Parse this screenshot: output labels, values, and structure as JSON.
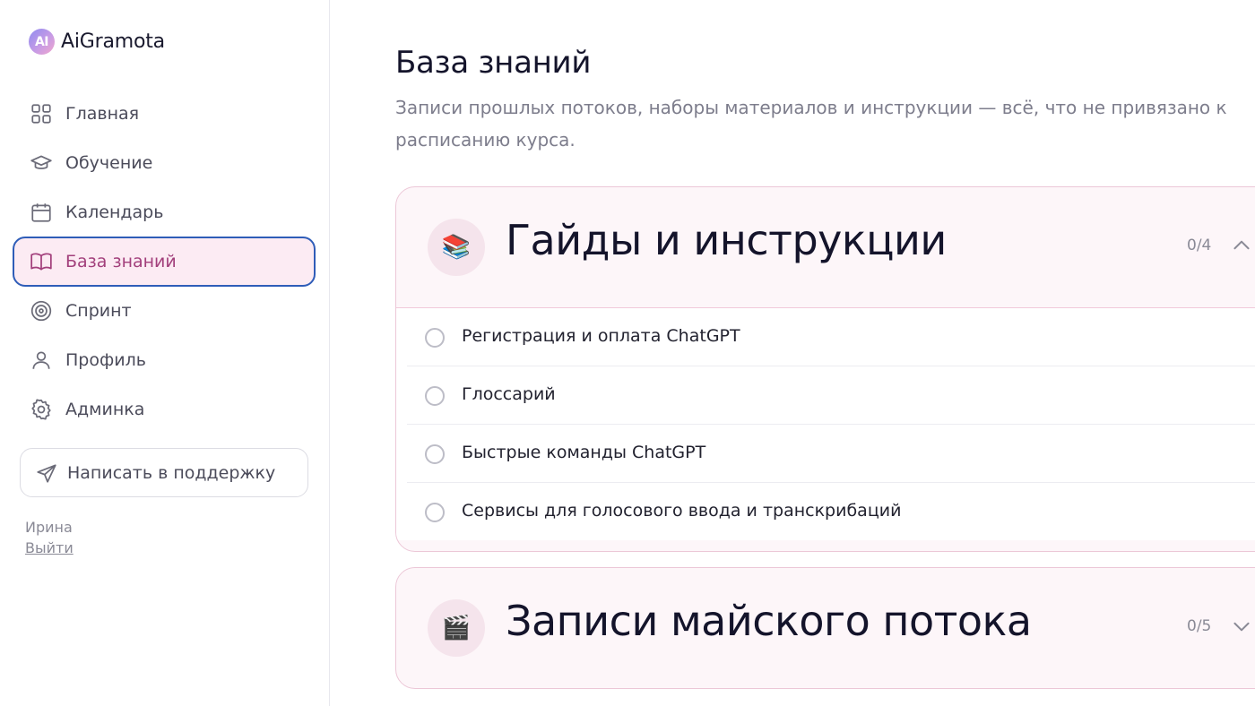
{
  "brand": {
    "logo_mark": "AI",
    "name": "AiGramota"
  },
  "sidebar": {
    "items": [
      {
        "label": "Главная",
        "icon": "grid-icon",
        "active": false
      },
      {
        "label": "Обучение",
        "icon": "graduation-cap-icon",
        "active": false
      },
      {
        "label": "Календарь",
        "icon": "calendar-icon",
        "active": false
      },
      {
        "label": "База знаний",
        "icon": "book-icon",
        "active": true
      },
      {
        "label": "Спринт",
        "icon": "target-icon",
        "active": false
      },
      {
        "label": "Профиль",
        "icon": "user-icon",
        "active": false
      },
      {
        "label": "Админка",
        "icon": "gear-icon",
        "active": false
      }
    ],
    "support_label": "Написать в поддержку",
    "user_name": "Ирина",
    "logout_label": "Выйти"
  },
  "main": {
    "title": "База знаний",
    "subtitle": "Записи прошлых потоков, наборы материалов и инструкции — всё, что не привязано к расписанию курса.",
    "sections": [
      {
        "emoji": "📚",
        "title": "Гайды и инструкции",
        "count": "0/4",
        "expanded": true,
        "lessons": [
          "Регистрация и оплата ChatGPT",
          "Глоссарий",
          "Быстрые команды ChatGPT",
          "Сервисы для голосового ввода и транскрибаций"
        ]
      },
      {
        "emoji": "🎬",
        "title": "Записи майского потока",
        "count": "0/5",
        "expanded": false,
        "lessons": []
      }
    ]
  },
  "colors": {
    "accent": "#a23f7b",
    "active_bg": "#fcebf3",
    "focus_ring": "#2f5db8",
    "card_bg": "#fdf6f9",
    "card_border": "#ecc7d7"
  }
}
